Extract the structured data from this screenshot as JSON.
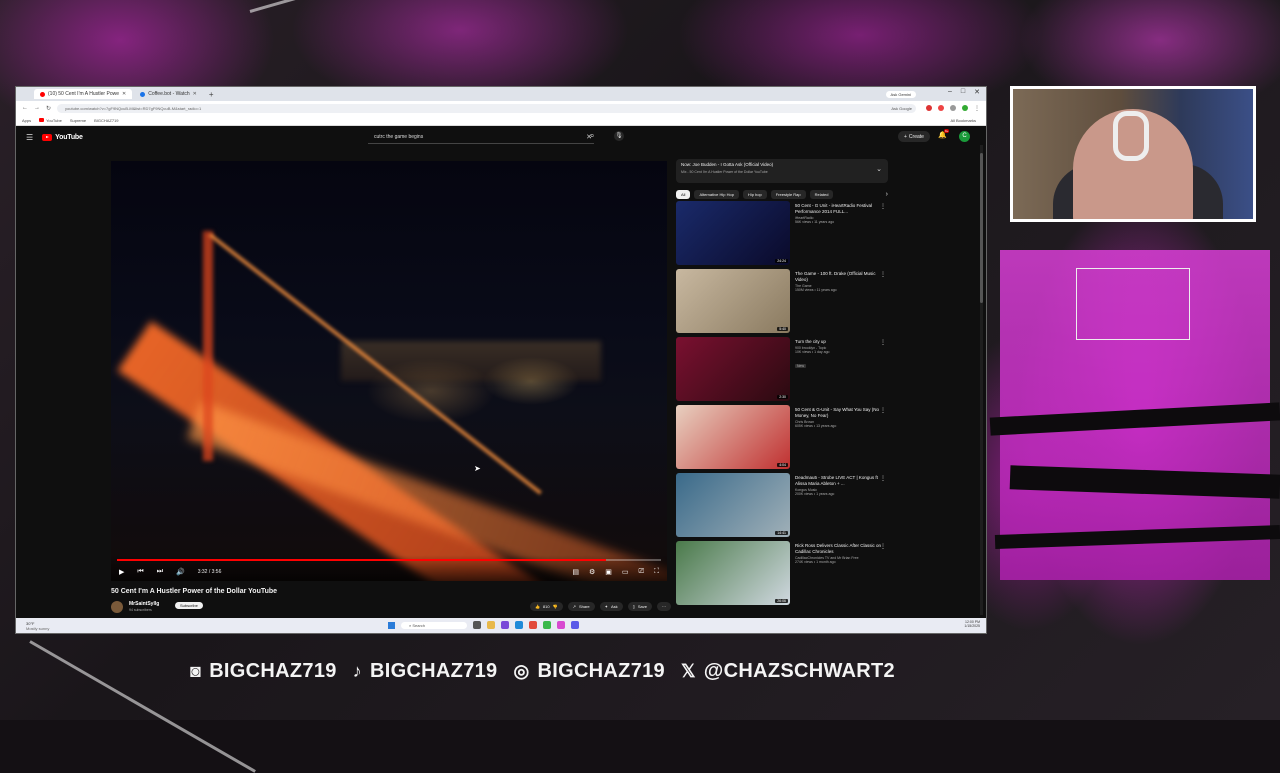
{
  "browser": {
    "tabs": [
      {
        "label": "(10) 50 Cent I'm A Hustler Powe",
        "active": true,
        "color": "#ff0000"
      },
      {
        "label": "Coffee.bot - Watch",
        "active": false,
        "color": "#1a73e8"
      }
    ],
    "ask_gemini": "Ask Gemini",
    "url": "youtube.com/watch?v=7gF9NQcuB-M&list=RD7gF9NQcuB-M&start_radio=1",
    "ask_google": "Ask Google",
    "bookmarks": [
      "Apps",
      "YouTube",
      "Supreme",
      "BIGCHAZ719"
    ],
    "all_bookmarks": "All Bookmarks"
  },
  "youtube": {
    "logo": "YouTube",
    "search_query": "cutrc the game begins",
    "create_label": "Create",
    "notification_count": "9+",
    "avatar_letter": "C"
  },
  "player": {
    "current_time": "3:32",
    "duration": "3:56",
    "time_display": "3:32 / 3:56",
    "progress": 0.898
  },
  "video": {
    "title": "50 Cent I'm A Hustler Power of the Dollar YouTube",
    "channel": "MrSaintSyllg",
    "subscribers": "94 subscribers",
    "subscribe_label": "Subscribe",
    "likes": "810",
    "share_label": "Share",
    "ask_label": "Ask",
    "save_label": "Save"
  },
  "mix": {
    "title": "Now: Joe Budden - I Gotta Ask (Official Video)",
    "subtitle": "Mix - 50 Cent I'm A Hustler Power of the Dollar YouTube"
  },
  "chips": [
    "All",
    "Alternative Hip Hop",
    "Hip hop",
    "Freestyle Rap",
    "Related"
  ],
  "recommendations": [
    {
      "title": "50 Cent - G Unit - iHeartRadio Festival Performance 2014 FULL...",
      "channel": "iHeartRadio",
      "meta": "56K views • 11 years ago",
      "duration": "24:24",
      "thumb_a": "#1a2a6a",
      "thumb_b": "#0a0a2a"
    },
    {
      "title": "The Game - 100 ft. Drake (Official Music Video)",
      "channel": "The Game",
      "meta": "150M views • 11 years ago",
      "duration": "5:40",
      "thumb_a": "#c8b8a0",
      "thumb_b": "#8a7a60"
    },
    {
      "title": "Turn the city up",
      "channel": "900 brooklyn - Topic",
      "meta": "10K views • 1 day ago",
      "duration": "2:30",
      "thumb_a": "#7a1030",
      "thumb_b": "#2a0a10",
      "badge": "New"
    },
    {
      "title": "50 Cent & G-Unit - Say What You Say (No Money, No Fear)",
      "channel": "Chris Brown",
      "meta": "605K views • 13 years ago",
      "duration": "4:04",
      "thumb_a": "#e8d0c0",
      "thumb_b": "#c03030"
    },
    {
      "title": "Deadmau5 - Strobe LIVE ACT | Kongus ft Alissa Maria Ableton + ...",
      "channel": "Kongus Music",
      "meta": "200K views • 1 years ago",
      "duration": "14:41",
      "thumb_a": "#3a6a8a",
      "thumb_b": "#a0b0b8"
    },
    {
      "title": "Rick Ross Delivers Classic After Classic on Cadillac Chronicles",
      "channel": "CadillacChronicles TV and Mr Brian Free",
      "meta": "274K views • 1 month ago",
      "duration": "26:06",
      "thumb_a": "#4a7a4a",
      "thumb_b": "#d0d8e0"
    }
  ],
  "taskbar": {
    "weather": "30°F",
    "weather_sub": "Mostly sunny",
    "search_placeholder": "Search",
    "time": "12:00 PM",
    "date": "1/15/2025"
  },
  "social": [
    {
      "icon": "twitch-icon",
      "handle": "BIGCHAZ719"
    },
    {
      "icon": "tiktok-icon",
      "handle": "BIGCHAZ719"
    },
    {
      "icon": "instagram-icon",
      "handle": "BIGCHAZ719"
    },
    {
      "icon": "x-icon",
      "handle": "@CHAZSCHWART2"
    }
  ],
  "colors": {
    "accent": "#ff0000",
    "overlay_pink": "#d93ed6"
  }
}
